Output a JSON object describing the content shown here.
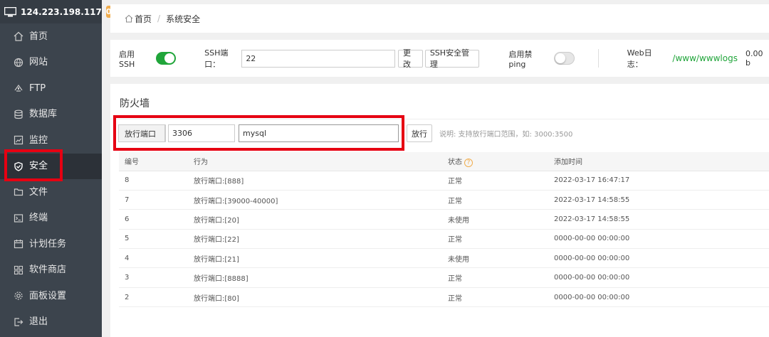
{
  "sidebar": {
    "ip": "124.223.198.117",
    "badge": "0",
    "items": [
      {
        "label": "首页",
        "icon": "home-icon"
      },
      {
        "label": "网站",
        "icon": "globe-icon"
      },
      {
        "label": "FTP",
        "icon": "ftp-icon"
      },
      {
        "label": "数据库",
        "icon": "database-icon"
      },
      {
        "label": "监控",
        "icon": "monitor-chart-icon"
      },
      {
        "label": "安全",
        "icon": "shield-icon"
      },
      {
        "label": "文件",
        "icon": "folder-icon"
      },
      {
        "label": "终端",
        "icon": "terminal-icon"
      },
      {
        "label": "计划任务",
        "icon": "calendar-icon"
      },
      {
        "label": "软件商店",
        "icon": "grid-icon"
      },
      {
        "label": "面板设置",
        "icon": "gear-icon"
      },
      {
        "label": "退出",
        "icon": "logout-icon"
      }
    ],
    "active_index": 5
  },
  "breadcrumb": {
    "home": "首页",
    "separator": "/",
    "current": "系统安全"
  },
  "ssh": {
    "enable_label": "启用SSH",
    "port_label": "SSH端口：",
    "port_value": "22",
    "change_button": "更改",
    "manage_button": "SSH安全管理",
    "ping_label": "启用禁ping",
    "weblog_label": "Web日志：",
    "weblog_path": "/www/wwwlogs",
    "weblog_size": "0.00 b"
  },
  "firewall": {
    "title": "防火墙",
    "type_select": "放行端口",
    "port_value": "3306",
    "remark_value": "mysql",
    "add_button": "放行",
    "hint": "说明: 支持放行端口范围，如: 3000:3500",
    "headers": {
      "id": "编号",
      "action": "行为",
      "status": "状态",
      "time": "添加时间"
    },
    "status_help": "?",
    "rows": [
      {
        "id": "8",
        "action": "放行端口:[888]",
        "status": "正常",
        "time": "2022-03-17 16:47:17"
      },
      {
        "id": "7",
        "action": "放行端口:[39000-40000]",
        "status": "正常",
        "time": "2022-03-17 14:58:55"
      },
      {
        "id": "6",
        "action": "放行端口:[20]",
        "status": "未使用",
        "time": "2022-03-17 14:58:55"
      },
      {
        "id": "5",
        "action": "放行端口:[22]",
        "status": "正常",
        "time": "0000-00-00 00:00:00"
      },
      {
        "id": "4",
        "action": "放行端口:[21]",
        "status": "未使用",
        "time": "0000-00-00 00:00:00"
      },
      {
        "id": "3",
        "action": "放行端口:[8888]",
        "status": "正常",
        "time": "0000-00-00 00:00:00"
      },
      {
        "id": "2",
        "action": "放行端口:[80]",
        "status": "正常",
        "time": "0000-00-00 00:00:00"
      }
    ]
  },
  "colors": {
    "accent_green": "#20a53a",
    "highlight_red": "#e60012",
    "badge_orange": "#f0ad4e",
    "sidebar_bg": "#3c444d"
  }
}
